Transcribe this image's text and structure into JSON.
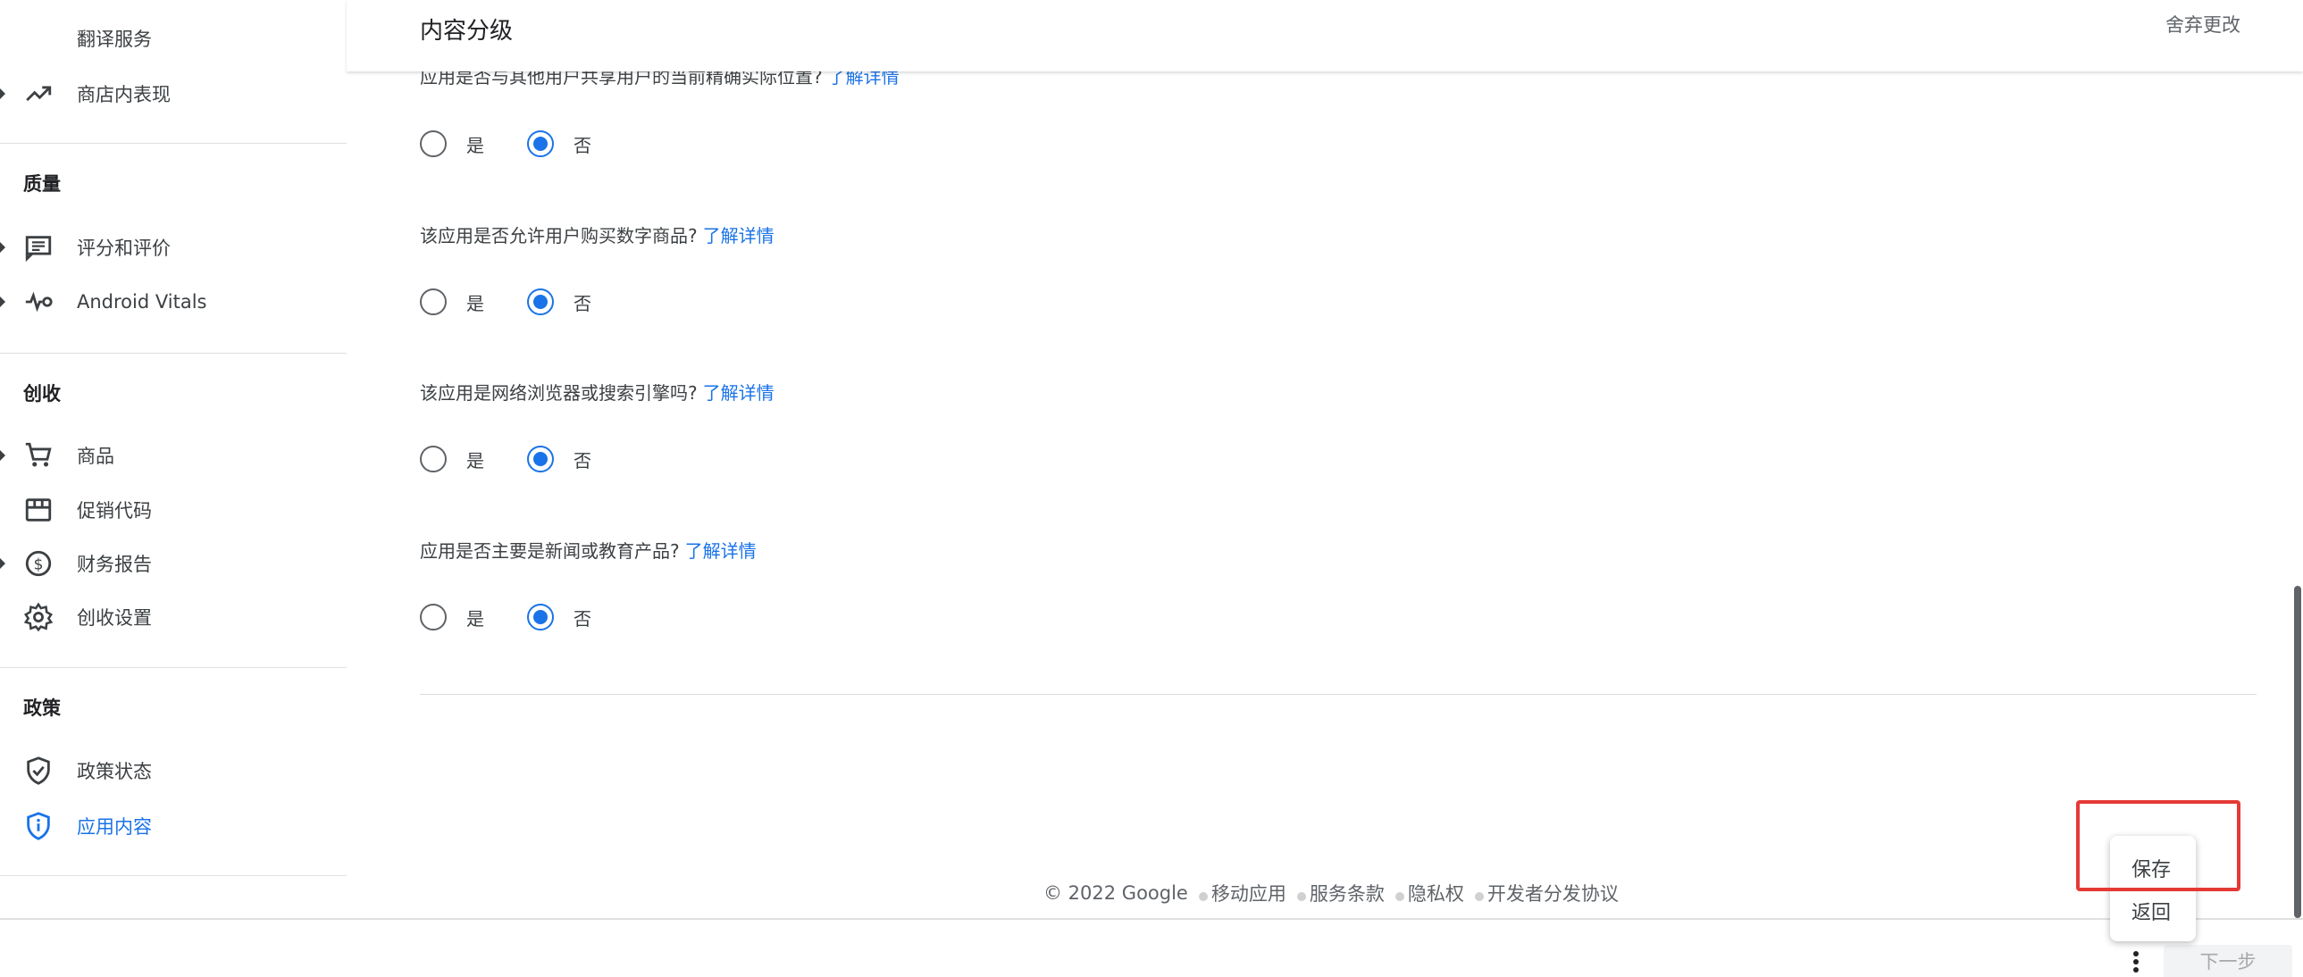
{
  "sidebar": {
    "items": [
      {
        "label": "翻译服务",
        "icon": "",
        "arrow": false
      },
      {
        "label": "商店内表现",
        "icon": "trending-up-icon",
        "arrow": true
      },
      {
        "label": "评分和评价",
        "icon": "review-icon",
        "arrow": true
      },
      {
        "label": "Android Vitals",
        "icon": "vitals-icon",
        "arrow": true
      },
      {
        "label": "商品",
        "icon": "cart-icon",
        "arrow": true
      },
      {
        "label": "促销代码",
        "icon": "store-icon",
        "arrow": false
      },
      {
        "label": "财务报告",
        "icon": "dollar-icon",
        "arrow": true
      },
      {
        "label": "创收设置",
        "icon": "gear-icon",
        "arrow": false
      },
      {
        "label": "政策状态",
        "icon": "shield-check-icon",
        "arrow": false
      },
      {
        "label": "应用内容",
        "icon": "shield-info-icon",
        "arrow": false,
        "active": true
      }
    ],
    "sections": {
      "quality": "质量",
      "monetize": "创收",
      "policy": "政策"
    }
  },
  "header": {
    "title": "内容分级",
    "discard": "舍弃更改"
  },
  "questions": [
    {
      "text": "应用是否与其他用户共享用户的当前精确实际位置?",
      "link": "了解详情",
      "selected": "no"
    },
    {
      "text": "该应用是否允许用户购买数字商品?",
      "link": "了解详情",
      "selected": "no"
    },
    {
      "text": "该应用是网络浏览器或搜索引擎吗?",
      "link": "了解详情",
      "selected": "no"
    },
    {
      "text": "应用是否主要是新闻或教育产品?",
      "link": "了解详情",
      "selected": "no"
    }
  ],
  "options": {
    "yes": "是",
    "no": "否"
  },
  "footer": {
    "copyright": "© 2022 Google",
    "links": [
      "移动应用",
      "服务条款",
      "隐私权",
      "开发者分发协议"
    ]
  },
  "popup_menu": {
    "save": "保存",
    "back": "返回"
  },
  "bottom_bar": {
    "next": "下一步"
  },
  "colors": {
    "accent": "#1a73e8",
    "highlight": "#e53935",
    "text": "#3c4043"
  }
}
